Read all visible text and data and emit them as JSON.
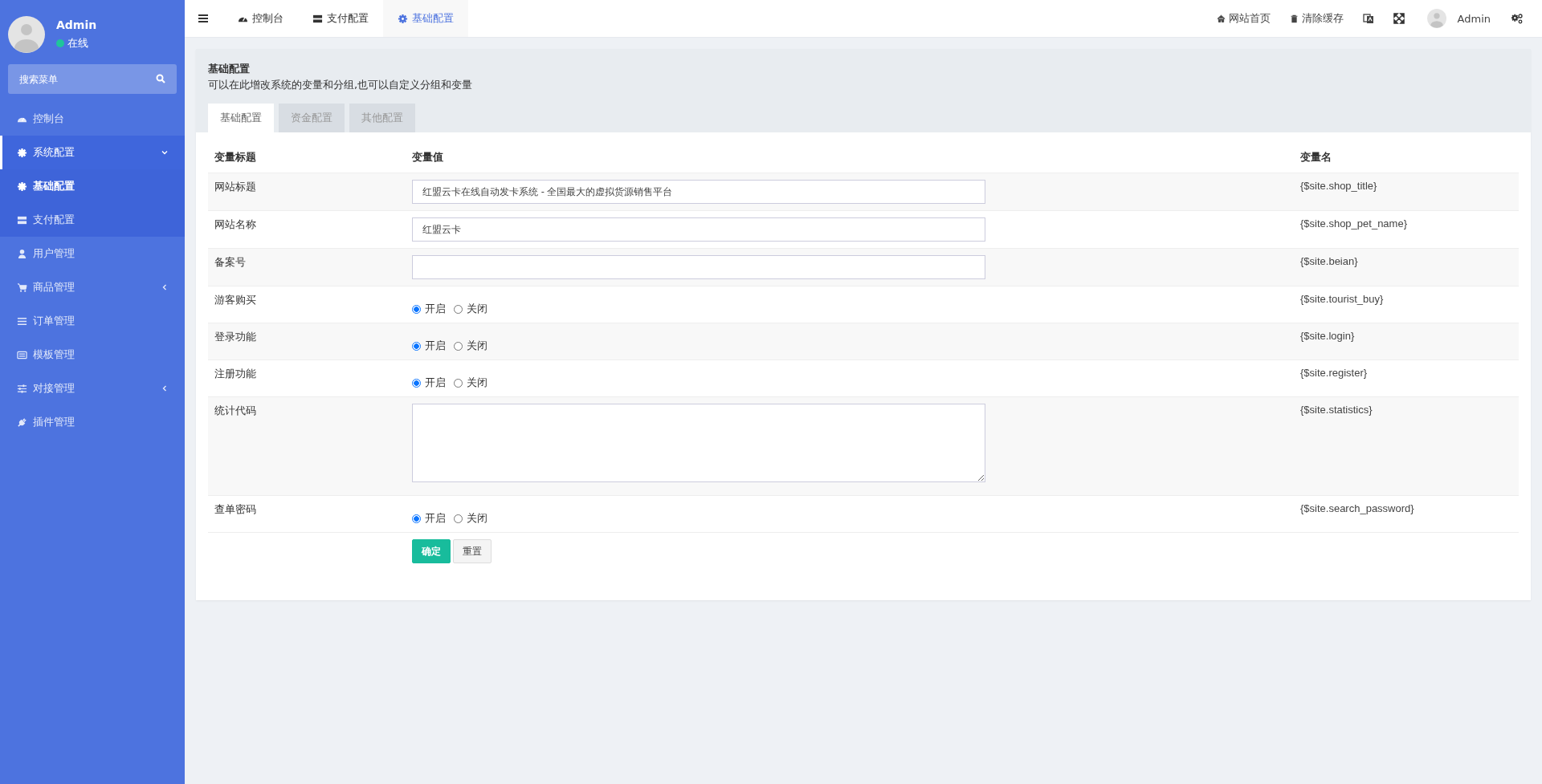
{
  "sidebar": {
    "user": {
      "name": "Admin",
      "status": "在线"
    },
    "search": {
      "placeholder": "搜索菜单"
    },
    "items": [
      {
        "label": "控制台",
        "selected": false
      },
      {
        "label": "系统配置",
        "selected": false,
        "expanded": true,
        "children": [
          {
            "label": "基础配置",
            "selected": true
          },
          {
            "label": "支付配置",
            "selected": false
          }
        ]
      },
      {
        "label": "用户管理",
        "selected": false
      },
      {
        "label": "商品管理",
        "selected": false,
        "expanded": false
      },
      {
        "label": "订单管理",
        "selected": false
      },
      {
        "label": "模板管理",
        "selected": false
      },
      {
        "label": "对接管理",
        "selected": false,
        "expanded": false
      },
      {
        "label": "插件管理",
        "selected": false
      }
    ]
  },
  "topbar": {
    "tabs": [
      {
        "label": "控制台",
        "selected": false
      },
      {
        "label": "支付配置",
        "selected": false
      },
      {
        "label": "基础配置",
        "selected": true
      }
    ],
    "links": [
      "网站首页",
      "清除缓存"
    ],
    "user": "Admin"
  },
  "panel": {
    "title": "基础配置",
    "subtitle": "可以在此增改系统的变量和分组,也可以自定义分组和变量",
    "tabs": [
      {
        "label": "基础配置",
        "selected": true
      },
      {
        "label": "资金配置",
        "selected": false
      },
      {
        "label": "其他配置",
        "selected": false
      }
    ],
    "columns": [
      "变量标题",
      "变量值",
      "变量名"
    ],
    "rows": [
      {
        "kind": "text",
        "title": "网站标题",
        "value": "红盟云卡在线自动发卡系统 - 全国最大的虚拟货源销售平台",
        "name": "{$site.shop_title}"
      },
      {
        "kind": "text",
        "title": "网站名称",
        "value": "红盟云卡",
        "name": "{$site.shop_pet_name}"
      },
      {
        "kind": "text",
        "title": "备案号",
        "name": "{$site.beian}"
      },
      {
        "kind": "radio",
        "title": "游客购买",
        "options": [
          {
            "label": "开启",
            "selected": true
          },
          {
            "label": "关闭",
            "selected": false
          }
        ],
        "name": "{$site.tourist_buy}"
      },
      {
        "kind": "radio",
        "title": "登录功能",
        "options": [
          {
            "label": "开启",
            "selected": true
          },
          {
            "label": "关闭",
            "selected": false
          }
        ],
        "name": "{$site.login}"
      },
      {
        "kind": "radio",
        "title": "注册功能",
        "options": [
          {
            "label": "开启",
            "selected": true
          },
          {
            "label": "关闭",
            "selected": false
          }
        ],
        "name": "{$site.register}"
      },
      {
        "kind": "textarea",
        "title": "统计代码",
        "name": "{$site.statistics}"
      },
      {
        "kind": "radio",
        "title": "查单密码",
        "options": [
          {
            "label": "开启",
            "selected": true
          },
          {
            "label": "关闭",
            "selected": false
          }
        ],
        "name": "{$site.search_password}"
      }
    ],
    "buttons": [
      "确定",
      "重置"
    ]
  }
}
